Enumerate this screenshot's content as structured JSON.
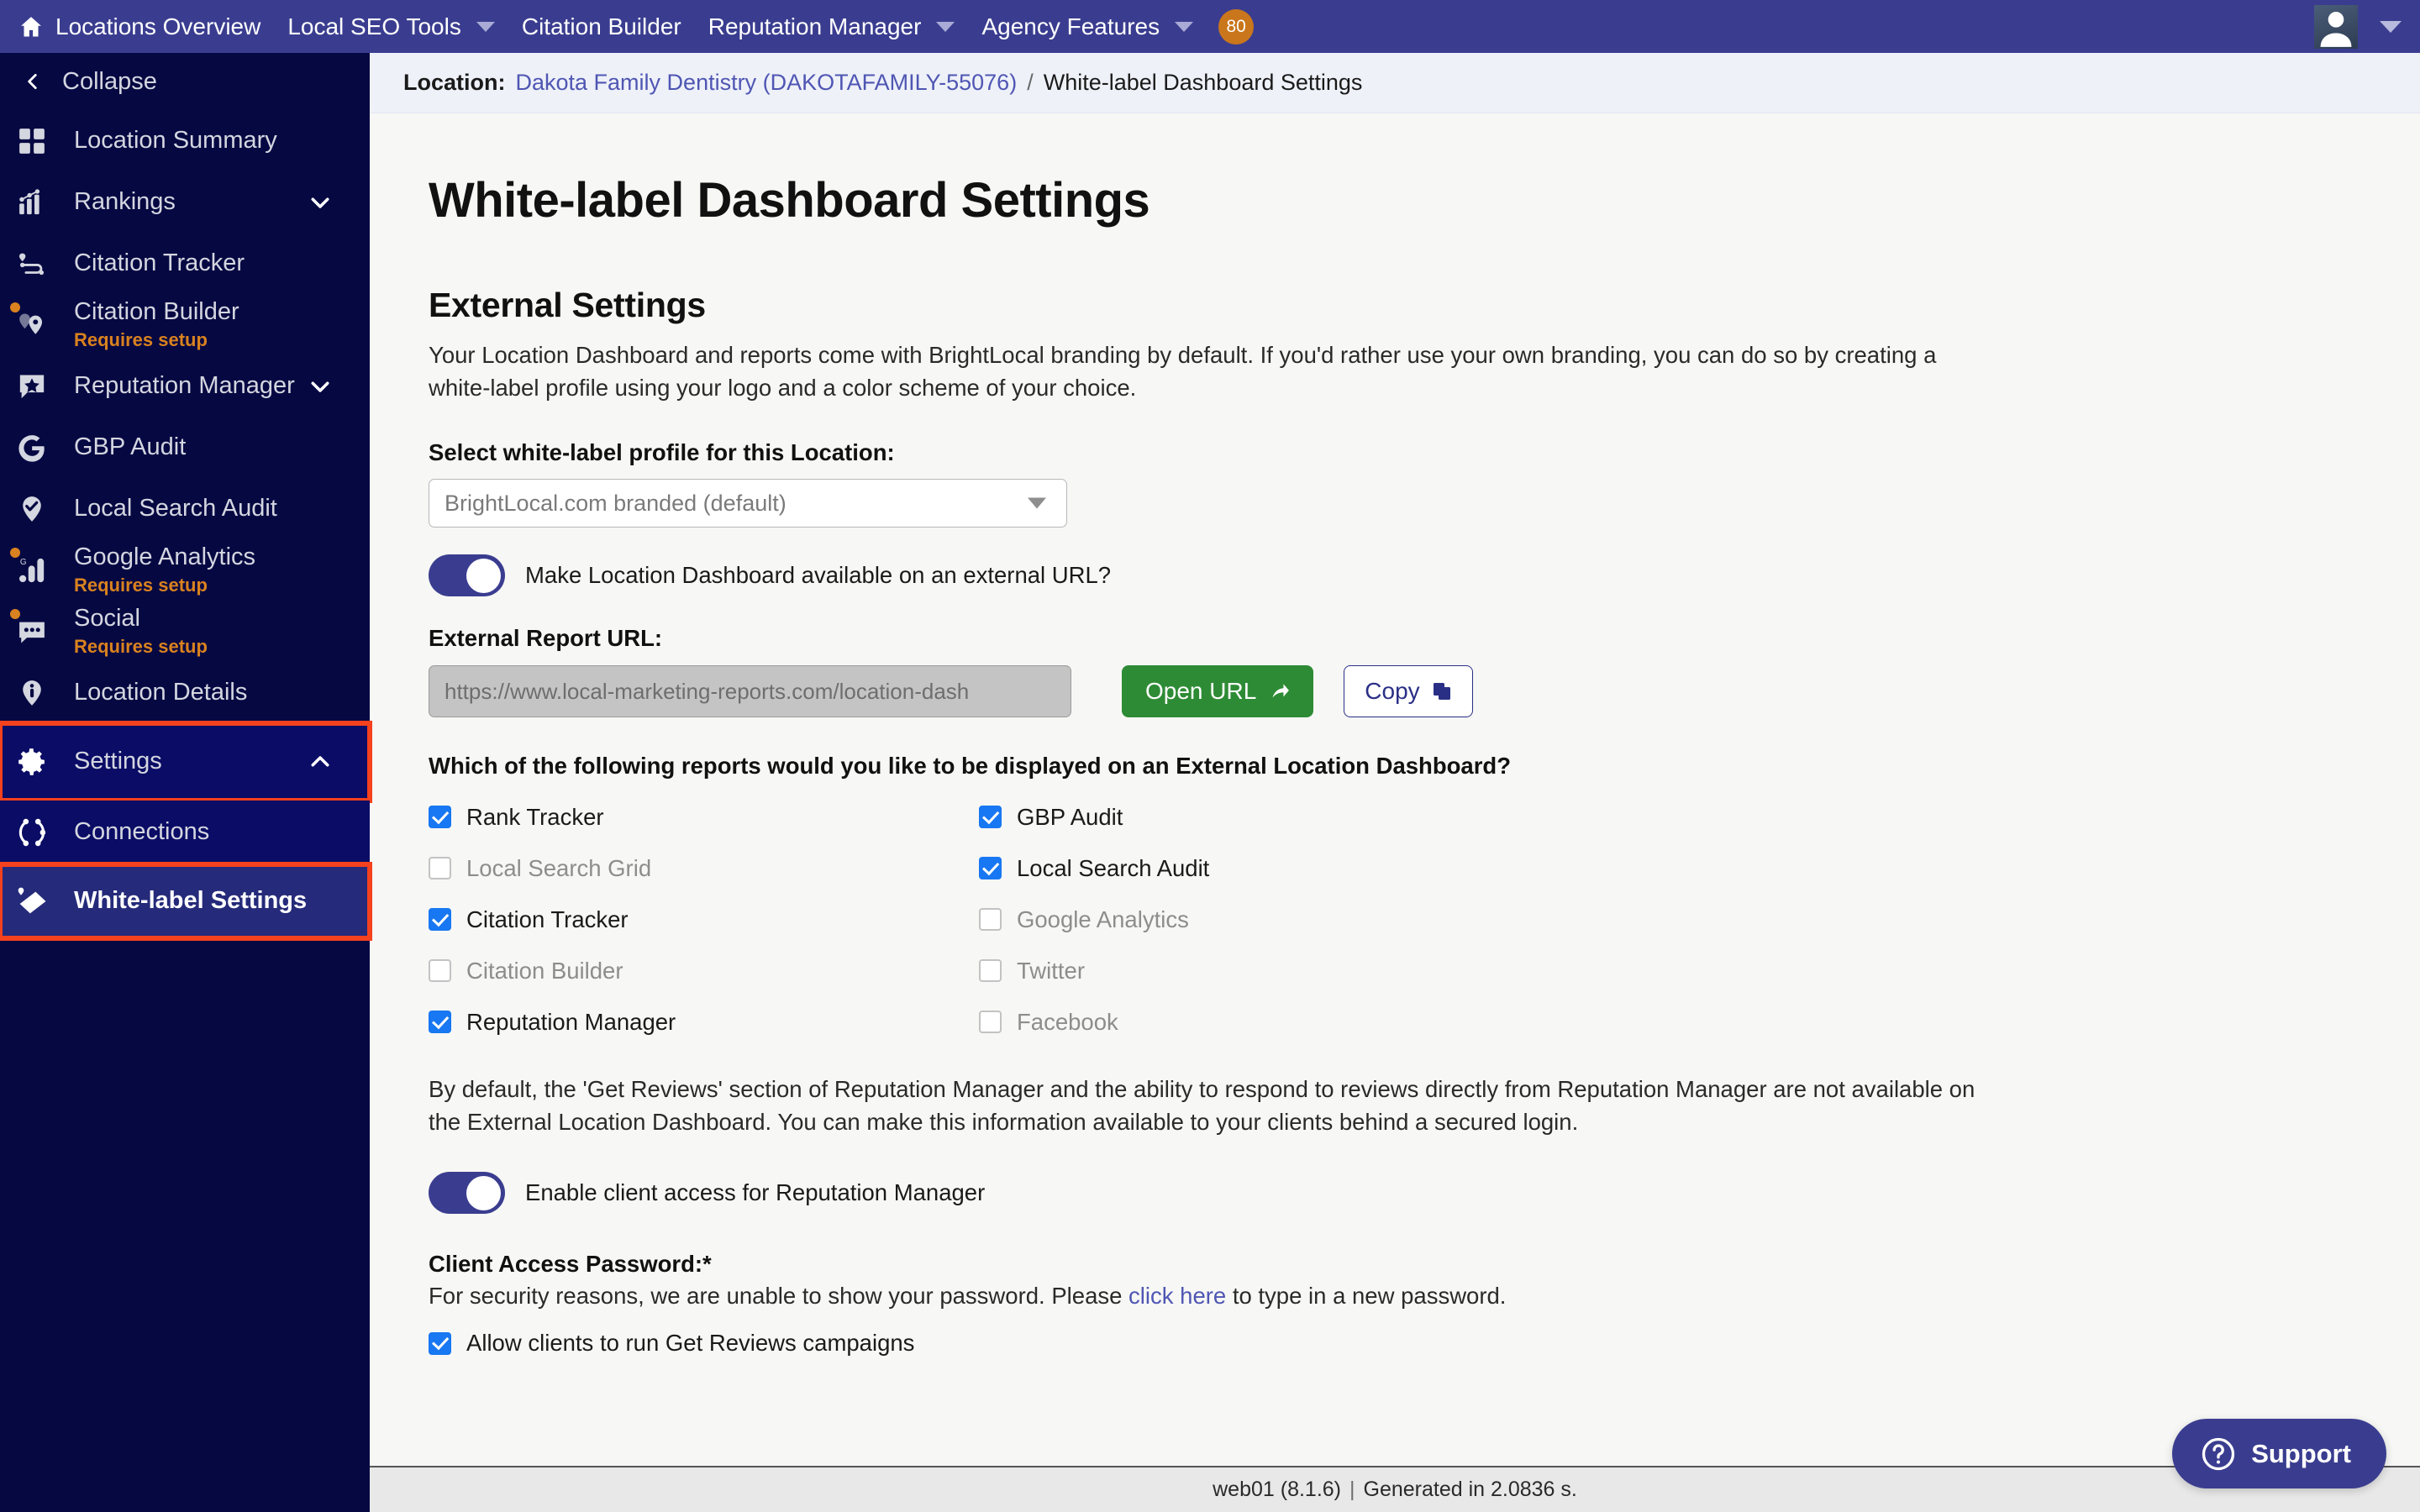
{
  "topnav": {
    "home_icon": "home-icon",
    "items": [
      {
        "label": "Locations Overview",
        "has_caret": false
      },
      {
        "label": "Local SEO Tools",
        "has_caret": true
      },
      {
        "label": "Citation Builder",
        "has_caret": false
      },
      {
        "label": "Reputation Manager",
        "has_caret": true
      },
      {
        "label": "Agency Features",
        "has_caret": true
      }
    ],
    "badge": "80",
    "user_icon": "user-avatar-icon"
  },
  "sidebar": {
    "collapse_label": "Collapse",
    "items": [
      {
        "label": "Location Summary",
        "icon": "grid-icon",
        "sub": "",
        "chevron": "",
        "state": ""
      },
      {
        "label": "Rankings",
        "icon": "bar-chart-icon",
        "sub": "",
        "chevron": "down",
        "state": ""
      },
      {
        "label": "Citation Tracker",
        "icon": "route-pin-icon",
        "sub": "",
        "chevron": "",
        "state": ""
      },
      {
        "label": "Citation Builder",
        "icon": "map-pins-icon",
        "sub": "Requires setup",
        "chevron": "",
        "state": "alert"
      },
      {
        "label": "Reputation Manager",
        "icon": "star-bubble-icon",
        "sub": "",
        "chevron": "down",
        "state": ""
      },
      {
        "label": "GBP Audit",
        "icon": "google-g-icon",
        "sub": "",
        "chevron": "",
        "state": ""
      },
      {
        "label": "Local Search Audit",
        "icon": "pin-check-icon",
        "sub": "",
        "chevron": "",
        "state": ""
      },
      {
        "label": "Google Analytics",
        "icon": "google-analytics-icon",
        "sub": "Requires setup",
        "chevron": "",
        "state": "alert"
      },
      {
        "label": "Social",
        "icon": "chat-bubble-icon",
        "sub": "Requires setup",
        "chevron": "",
        "state": "alert"
      },
      {
        "label": "Location Details",
        "icon": "info-pin-icon",
        "sub": "",
        "chevron": "",
        "state": ""
      },
      {
        "label": "Settings",
        "icon": "gear-icon",
        "sub": "",
        "chevron": "up",
        "state": "highlighted"
      },
      {
        "label": "Connections",
        "icon": "connections-icon",
        "sub": "",
        "chevron": "",
        "state": "active"
      },
      {
        "label": "White-label Settings",
        "icon": "white-label-icon",
        "sub": "",
        "chevron": "",
        "state": "current"
      }
    ]
  },
  "breadcrumb": {
    "label": "Location:",
    "link": "Dakota Family Dentistry (DAKOTAFAMILY-55076)",
    "separator": "/",
    "current": "White-label Dashboard Settings"
  },
  "main": {
    "page_title": "White-label Dashboard Settings",
    "section_title": "External Settings",
    "intro": "Your Location Dashboard and reports come with BrightLocal branding by default. If you'd rather use your own branding, you can do so by creating a white-label profile using your logo and a color scheme of your choice.",
    "profile_label": "Select white-label profile for this Location:",
    "profile_value": "BrightLocal.com branded (default)",
    "external_toggle_label": "Make Location Dashboard available on an external URL?",
    "external_toggle_on": true,
    "url_label": "External Report URL:",
    "url_value": "https://www.local-marketing-reports.com/location-dash",
    "open_url_button": "Open URL",
    "copy_button": "Copy",
    "reports_question": "Which of the following reports would you like to be displayed on an External Location Dashboard?",
    "reports": {
      "left": [
        {
          "label": "Rank Tracker",
          "checked": true,
          "enabled": true
        },
        {
          "label": "Local Search Grid",
          "checked": false,
          "enabled": false
        },
        {
          "label": "Citation Tracker",
          "checked": true,
          "enabled": true
        },
        {
          "label": "Citation Builder",
          "checked": false,
          "enabled": false
        },
        {
          "label": "Reputation Manager",
          "checked": true,
          "enabled": true
        }
      ],
      "right": [
        {
          "label": "GBP Audit",
          "checked": true,
          "enabled": true
        },
        {
          "label": "Local Search Audit",
          "checked": true,
          "enabled": true
        },
        {
          "label": "Google Analytics",
          "checked": false,
          "enabled": false
        },
        {
          "label": "Twitter",
          "checked": false,
          "enabled": false
        },
        {
          "label": "Facebook",
          "checked": false,
          "enabled": false
        }
      ]
    },
    "default_note": "By default, the 'Get Reviews' section of Reputation Manager and the ability to respond to reviews directly from Reputation Manager are not available on the External Location Dashboard. You can make this information available to your clients behind a secured login.",
    "client_access_toggle_label": "Enable client access for Reputation Manager",
    "client_access_toggle_on": true,
    "password_label": "Client Access Password:*",
    "password_text_before": "For security reasons, we are unable to show your password. Please ",
    "password_link": "click here",
    "password_text_after": " to type in a new password.",
    "allow_campaigns_label": "Allow clients to run Get Reviews campaigns",
    "allow_campaigns_checked": true
  },
  "footer": {
    "server": "web01 (8.1.6)",
    "separator": "|",
    "generated": "Generated in 2.0836 s."
  },
  "support": {
    "label": "Support",
    "icon": "question-circle-icon"
  },
  "colors": {
    "navbar": "#3a3d8f",
    "sidebar": "#060842",
    "sidebar_active": "#0a0c65",
    "highlight_outline": "#f4411e",
    "accent_orange": "#d9821f",
    "link_blue": "#4f56b3",
    "checkbox_blue": "#1877f2",
    "green_button": "#2e8b35"
  }
}
